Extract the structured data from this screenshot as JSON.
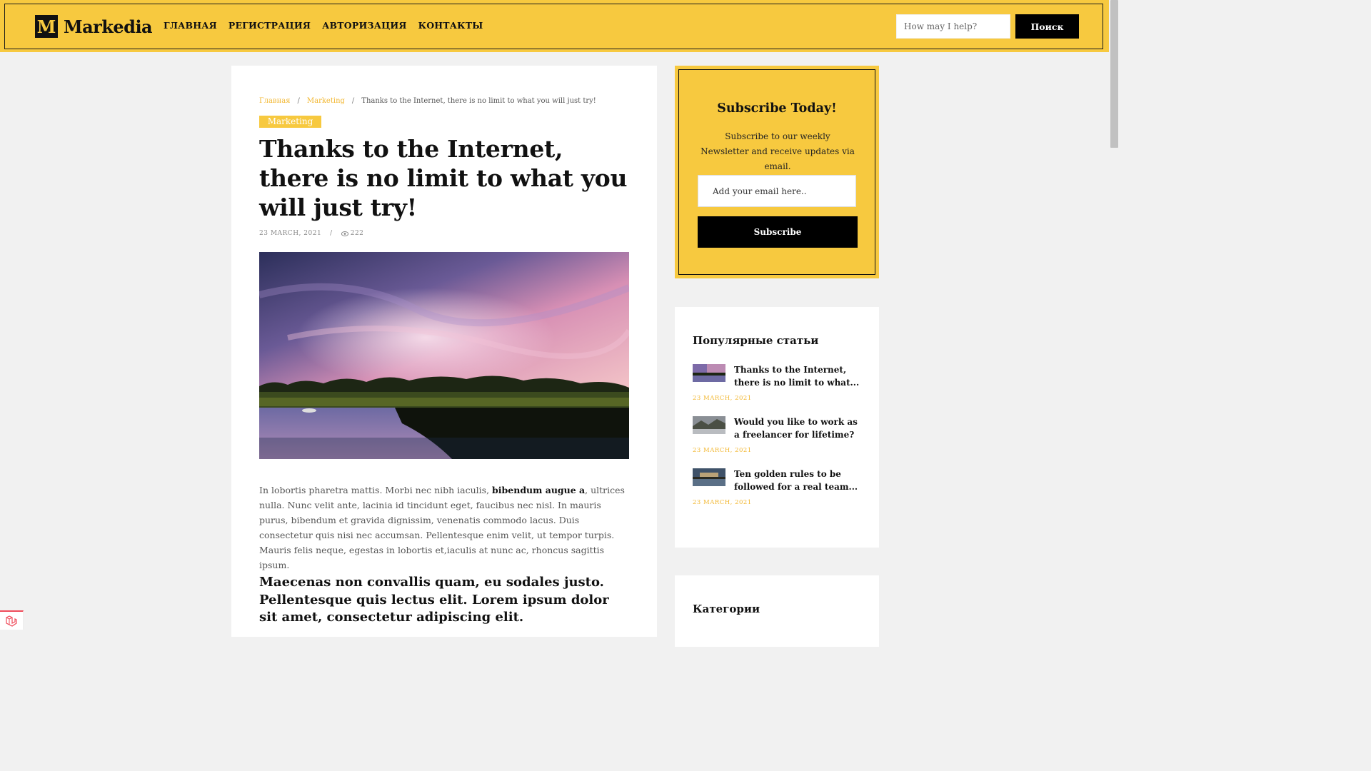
{
  "header": {
    "logo_letter": "M",
    "brand": "Markedia",
    "nav": [
      "ГЛАВНАЯ",
      "РЕГИСТРАЦИЯ",
      "АВТОРИЗАЦИЯ",
      "КОНТАКТЫ"
    ],
    "search_placeholder": "How may I help?",
    "search_button": "Поиск"
  },
  "article": {
    "breadcrumb": [
      "Главная",
      "Marketing",
      "Thanks to the Internet, there is no limit to what you will just try!"
    ],
    "breadcrumb_sep": "/",
    "category": "Marketing",
    "title": "Thanks to the Internet, there is no limit to what you will just try!",
    "date": "23 MARCH, 2021",
    "meta_sep": "/",
    "views": "222",
    "body_1": "In lobortis pharetra mattis. Morbi nec nibh iaculis, ",
    "body_bold": "bibendum augue a",
    "body_2": ", ultrices nulla. Nunc velit ante, lacinia id tincidunt eget, faucibus nec nisl. In mauris purus, bibendum et gravida dignissim, venenatis commodo lacus. Duis consectetur quis nisi nec accumsan. Pellentesque enim velit, ut tempor turpis. Mauris felis neque, egestas in lobortis et,iaculis at nunc ac, rhoncus sagittis ipsum.",
    "subheading": "Maecenas non convallis quam, eu sodales justo. Pellentesque quis lectus elit. Lorem ipsum dolor sit amet, consectetur adipiscing elit."
  },
  "subscribe": {
    "title": "Subscribe Today!",
    "description": "Subscribe to our weekly Newsletter and receive updates via email.",
    "email_placeholder": "Add your email here..",
    "button": "Subscribe"
  },
  "popular": {
    "title": "Популярные статьи",
    "items": [
      {
        "title": "Thanks to the Internet, there is no limit to what...",
        "date": "23 MARCH, 2021"
      },
      {
        "title": "Would you like to work as a freelancer for lifetime?",
        "date": "23 MARCH, 2021"
      },
      {
        "title": "Ten golden rules to be followed for a real team...",
        "date": "23 MARCH, 2021"
      }
    ]
  },
  "categories": {
    "title": "Категории"
  },
  "colors": {
    "accent": "#f7c93f",
    "link": "#f2b731",
    "dark": "#000000",
    "page_bg": "#f1f1f1"
  }
}
